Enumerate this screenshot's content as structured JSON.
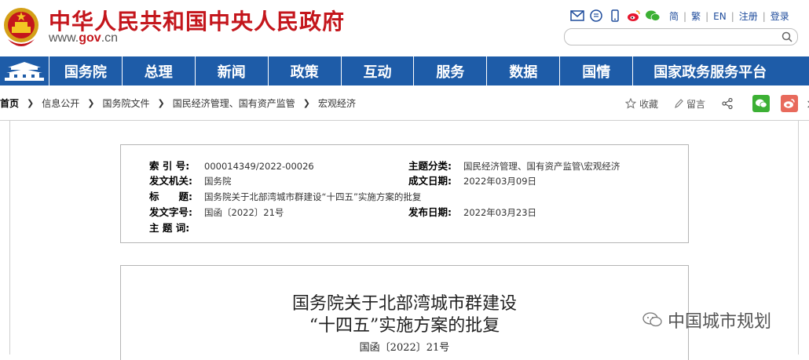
{
  "header": {
    "title": "中华人民共和国中央人民政府",
    "url_prefix": "www.",
    "url_brand": "gov",
    "url_suffix": ".cn",
    "links": [
      "简",
      "繁",
      "EN",
      "注册",
      "登录"
    ],
    "search_placeholder": ""
  },
  "nav": {
    "items": [
      "国务院",
      "总理",
      "新闻",
      "政策",
      "互动",
      "服务",
      "数据",
      "国情",
      "国家政务服务平台"
    ]
  },
  "breadcrumb": {
    "items": [
      "首页",
      "信息公开",
      "国务院文件",
      "国民经济管理、国有资产监管",
      "宏观经济"
    ]
  },
  "tools": {
    "favorite": "收藏",
    "comment": "留言"
  },
  "meta": {
    "index_label": "索 引 号:",
    "index_value": "000014349/2022-00026",
    "category_label": "主题分类:",
    "category_value": "国民经济管理、国有资产监管\\宏观经济",
    "issuer_label": "发文机关:",
    "issuer_value": "国务院",
    "created_label": "成文日期:",
    "created_value": "2022年03月09日",
    "title_label": "标　　题:",
    "title_value": "国务院关于北部湾城市群建设“十四五”实施方案的批复",
    "docno_label": "发文字号:",
    "docno_value": "国函〔2022〕21号",
    "published_label": "发布日期:",
    "published_value": "2022年03月23日",
    "keywords_label": "主 题 词:",
    "keywords_value": ""
  },
  "document": {
    "title_line1": "国务院关于北部湾城市群建设",
    "title_line2": "“十四五”实施方案的批复",
    "doc_number": "国函〔2022〕21号"
  },
  "watermark": "中国城市规划",
  "colors": {
    "brand_red": "#c4161c",
    "nav_blue": "#1e5ca8",
    "link_blue": "#1f4c9c",
    "wechat_green": "#3cb034",
    "weibo_red": "#e86a5c"
  }
}
